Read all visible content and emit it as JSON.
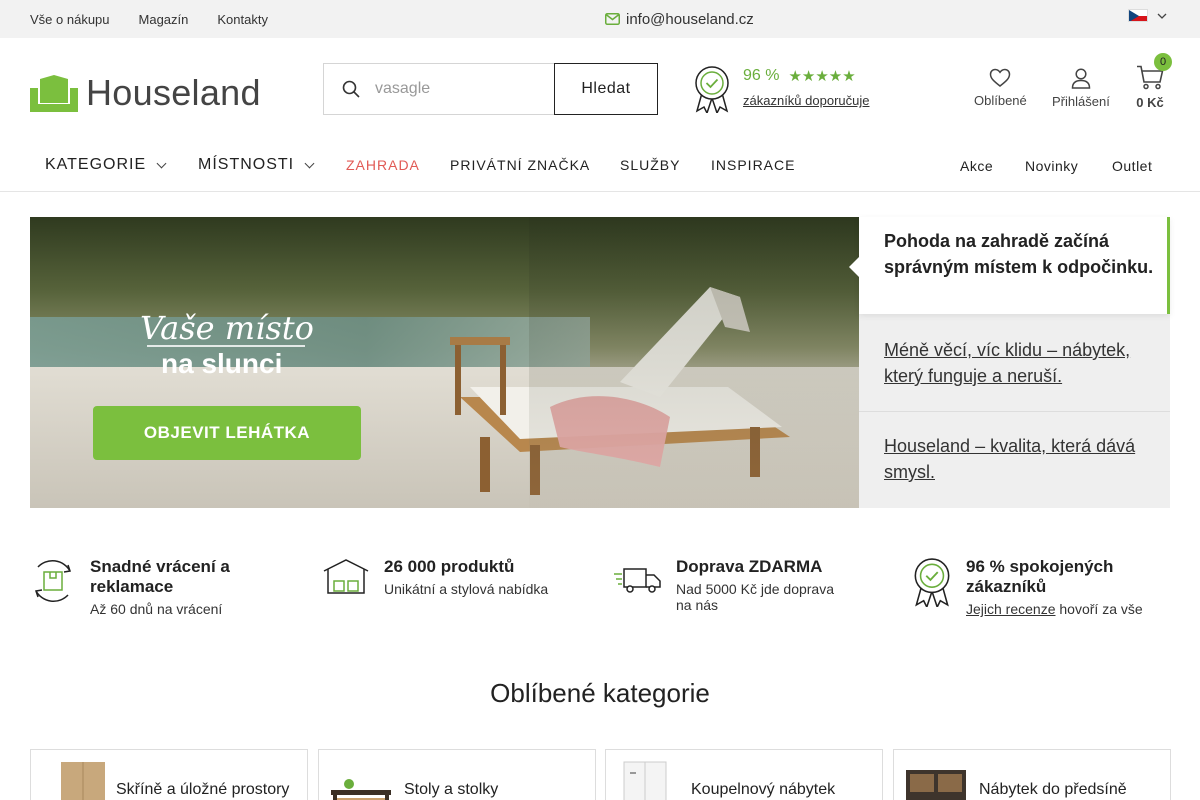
{
  "topbar": {
    "links": [
      "Vše o nákupu",
      "Magazín",
      "Kontakty"
    ],
    "email": "info@houseland.cz"
  },
  "header": {
    "logo": "Houseland",
    "search": {
      "placeholder": "vasagle",
      "button": "Hledat"
    },
    "rating": {
      "percent": "96 %",
      "stars": 5,
      "link": "zákazníků doporučuje"
    },
    "favorites": "Oblíbené",
    "login": "Přihlášení",
    "cart": {
      "count": "0",
      "total": "0 Kč"
    }
  },
  "nav": {
    "left": [
      {
        "label": "KATEGORIE",
        "dropdown": true
      },
      {
        "label": "MÍSTNOSTI",
        "dropdown": true
      },
      {
        "label": "ZAHRADA"
      },
      {
        "label": "PRIVÁTNÍ ZNAČKA"
      },
      {
        "label": "SLUŽBY"
      },
      {
        "label": "INSPIRACE"
      }
    ],
    "right": [
      "Akce",
      "Novinky",
      "Outlet"
    ]
  },
  "hero": {
    "title_script": "Vaše místo",
    "title_bold": "na slunci",
    "button": "OBJEVIT LEHÁTKA",
    "slides": [
      "Pohoda na zahradě začíná správným místem k odpočinku.",
      "Méně věcí, víc klidu – nábytek, který funguje a neruší.",
      "Houseland – kvalita, která dává smysl."
    ]
  },
  "usp": [
    {
      "title": "Snadné vrácení a reklamace",
      "sub": "Až 60 dnů na vrácení"
    },
    {
      "title": "26 000 produktů",
      "sub": "Unikátní a stylová nabídka"
    },
    {
      "title": "Doprava ZDARMA",
      "sub": "Nad 5000 Kč jde doprava na nás"
    },
    {
      "title": "96 % spokojených zákazníků",
      "sub_link": "Jejich recenze",
      "sub_rest": " hovoří za vše"
    }
  ],
  "categories": {
    "title": "Oblíbené kategorie",
    "items": [
      "Skříně a úložné prostory",
      "Stoly a stolky",
      "Koupelnový nábytek",
      "Nábytek do předsíně"
    ]
  },
  "colors": {
    "accent": "#7bbf3e",
    "garden": "#e15a55"
  }
}
